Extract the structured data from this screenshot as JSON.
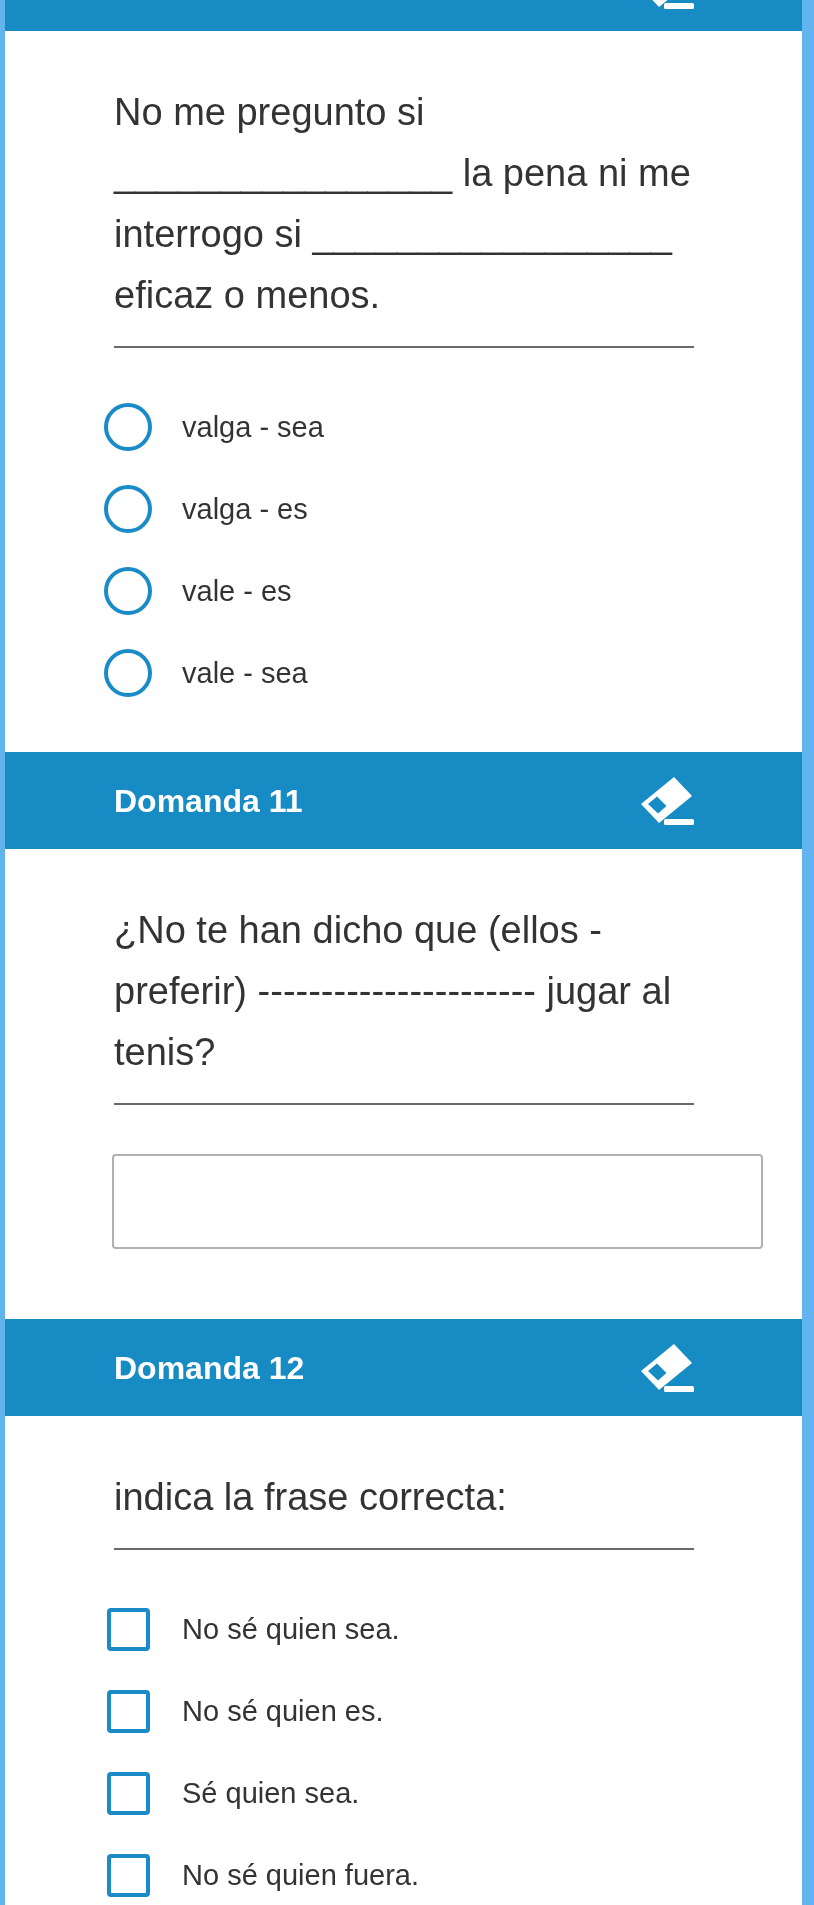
{
  "questions": [
    {
      "text": "No me pregunto si ________________ la pena ni me interrogo si _________________ eficaz o menos.",
      "kind": "single_choice",
      "options": [
        {
          "label": "valga - sea",
          "selected": false
        },
        {
          "label": "valga - es",
          "selected": false
        },
        {
          "label": "vale - es",
          "selected": false
        },
        {
          "label": "vale - sea",
          "selected": false
        }
      ]
    },
    {
      "title": "Domanda 11",
      "text": "¿No te han dicho que (ellos - preferir) ---------------------- jugar al tenis?",
      "kind": "text_answer"
    },
    {
      "title": "Domanda 12",
      "text": "indica la frase correcta:",
      "kind": "multiple_choice",
      "options": [
        {
          "label": "No sé quien sea.",
          "checked": false
        },
        {
          "label": "No sé quien es.",
          "checked": false
        },
        {
          "label": "Sé quien sea.",
          "checked": false
        },
        {
          "label": "No sé quien fuera.",
          "checked": false
        }
      ]
    }
  ]
}
